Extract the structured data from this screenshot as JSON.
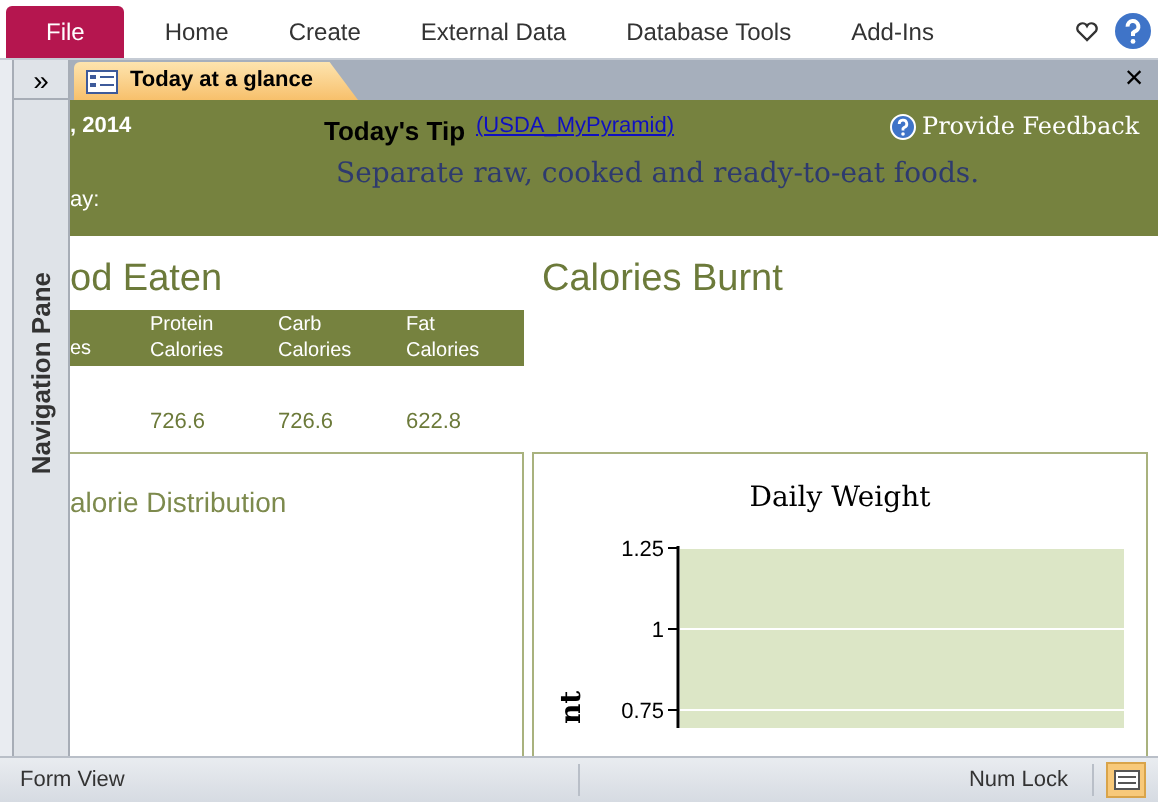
{
  "ribbon": {
    "tabs": [
      {
        "label": "File",
        "selected": true
      },
      {
        "label": "Home",
        "selected": false
      },
      {
        "label": "Create",
        "selected": false
      },
      {
        "label": "External Data",
        "selected": false
      },
      {
        "label": "Database Tools",
        "selected": false
      },
      {
        "label": "Add-Ins",
        "selected": false
      }
    ]
  },
  "navigation_pane": {
    "toggle": "»",
    "label": "Navigation Pane"
  },
  "document_tab": {
    "title": "Today at a glance",
    "close": "×"
  },
  "header": {
    "date": ", 2014",
    "label_2": "ay:",
    "tip_title": "Today's Tip",
    "tip_source": "(USDA_MyPyramid)",
    "tip": "Separate raw, cooked and ready-to-eat foods.",
    "feedback": "Provide Feedback"
  },
  "food_eaten": {
    "title": "od Eaten",
    "columns": [
      "es",
      "Protein Calories",
      "Carb Calories",
      "Fat Calories"
    ],
    "values": [
      "726.6",
      "726.6",
      "622.8"
    ]
  },
  "calories_burnt": {
    "title": "Calories Burnt"
  },
  "calorie_distribution": {
    "title": "alorie Distribution"
  },
  "daily_weight": {
    "title": "Daily Weight",
    "y_axis_label": "nt",
    "y_ticks": [
      "1.25",
      "1",
      "0.75"
    ]
  },
  "status_bar": {
    "view": "Form View",
    "num_lock": "Num Lock"
  }
}
